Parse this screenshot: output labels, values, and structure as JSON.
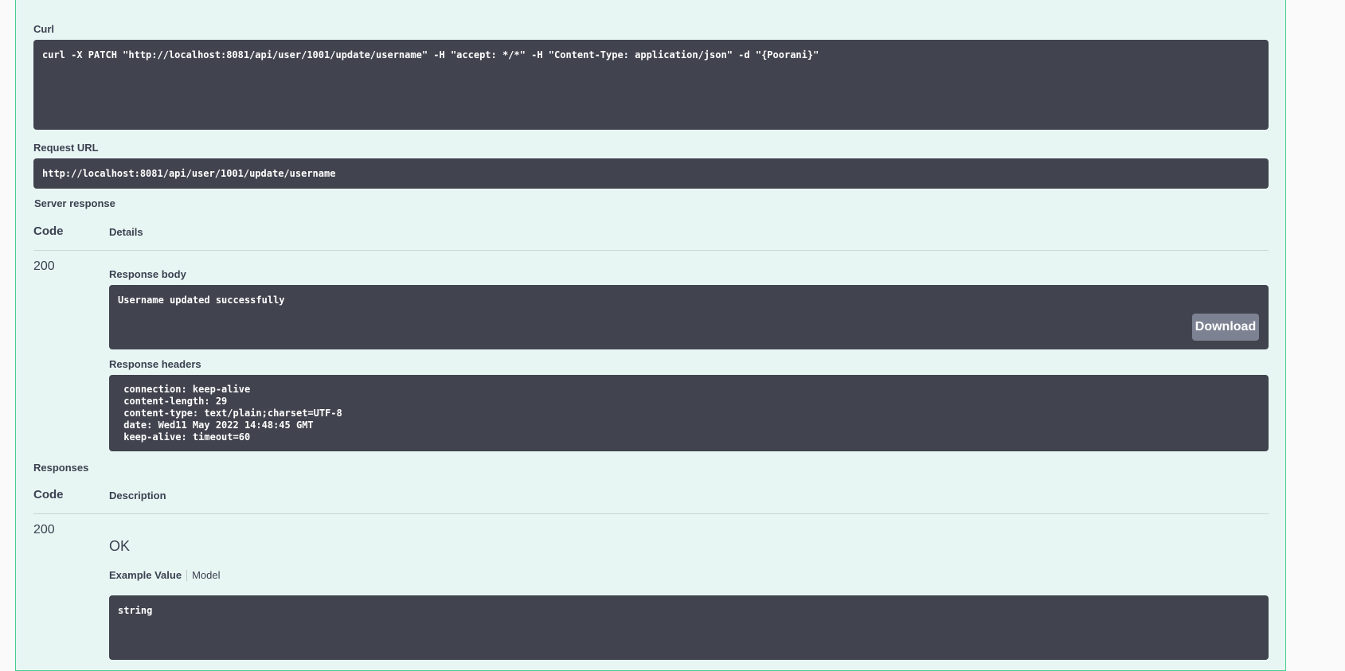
{
  "curl": {
    "label": "Curl",
    "command": "curl -X PATCH \"http://localhost:8081/api/user/1001/update/username\" -H \"accept: */*\" -H \"Content-Type: application/json\" -d \"{Poorani}\""
  },
  "request_url": {
    "label": "Request URL",
    "value": "http://localhost:8081/api/user/1001/update/username"
  },
  "server_response": {
    "label": "Server response",
    "col_code": "Code",
    "col_details": "Details",
    "code": "200",
    "body_label": "Response body",
    "body": "Username updated successfully",
    "download_label": "Download",
    "headers_label": "Response headers",
    "headers": " connection: keep-alive \n content-length: 29 \n content-type: text/plain;charset=UTF-8 \n date: Wed11 May 2022 14:48:45 GMT \n keep-alive: timeout=60 "
  },
  "responses": {
    "label": "Responses",
    "col_code": "Code",
    "col_description": "Description",
    "code": "200",
    "description": "OK",
    "tab_example": "Example Value",
    "tab_model": "Model",
    "example": "string"
  }
}
